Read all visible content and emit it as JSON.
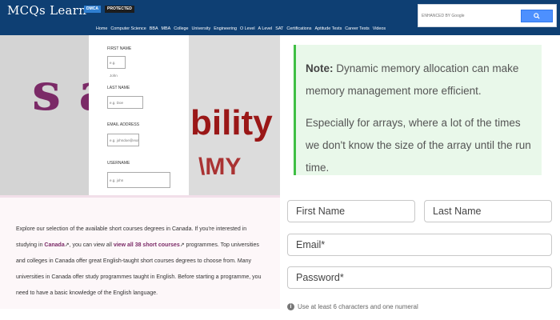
{
  "header": {
    "logo": "MCQs Learn",
    "badge_dmca": "DMCA",
    "badge_protected": "PROTECTED",
    "search": {
      "placeholder": "ENHANCED BY Google"
    },
    "nav": [
      "Home",
      "Computer Science",
      "BBA",
      "MBA",
      "College",
      "University",
      "Engineering",
      "O Level",
      "A Level",
      "SAT",
      "Certifications",
      "Aptitude Tests",
      "Career Tests",
      "Videos"
    ]
  },
  "sample_ad": {
    "form": {
      "first_label": "FIRST NAME",
      "first_placeholder": "e.g. John",
      "last_label": "LAST NAME",
      "last_placeholder": "e.g. Doe",
      "email_label": "EMAIL ADDRESS",
      "email_placeholder": "e.g. johndoe@example.com",
      "user_label": "USERNAME",
      "user_placeholder": "e.g. john"
    },
    "art": {
      "left_text": "s a",
      "right_text": "bility",
      "right_text2": "\\MY"
    }
  },
  "note": {
    "bold": "Note:",
    "line1": "Dynamic memory allocation can make memory management more efficient.",
    "line2": "Especially for arrays, where a lot of the times we don't know the size of the array until the run time."
  },
  "courses": {
    "p1": "Explore our selection of the available short courses degrees in Canada. If you're interested in studying in ",
    "link1": "Canada",
    "p2": ", you can view all ",
    "link2": "view all 38 short courses",
    "p3": " programmes. Top universities and colleges in Canada offer great English-taught short courses degrees to choose from. Many universities in Canada offer study programmes taught in English. Before starting a programme, you need to have a basic knowledge of the English language."
  },
  "signup": {
    "first_name": "First Name",
    "last_name": "Last Name",
    "email": "Email*",
    "password": "Password*",
    "hint": "Use at least 6 characters and one numeral"
  },
  "colors": {
    "header": "#0e3f73",
    "accent_green": "#3fbf44",
    "purple": "#7b2a67"
  }
}
